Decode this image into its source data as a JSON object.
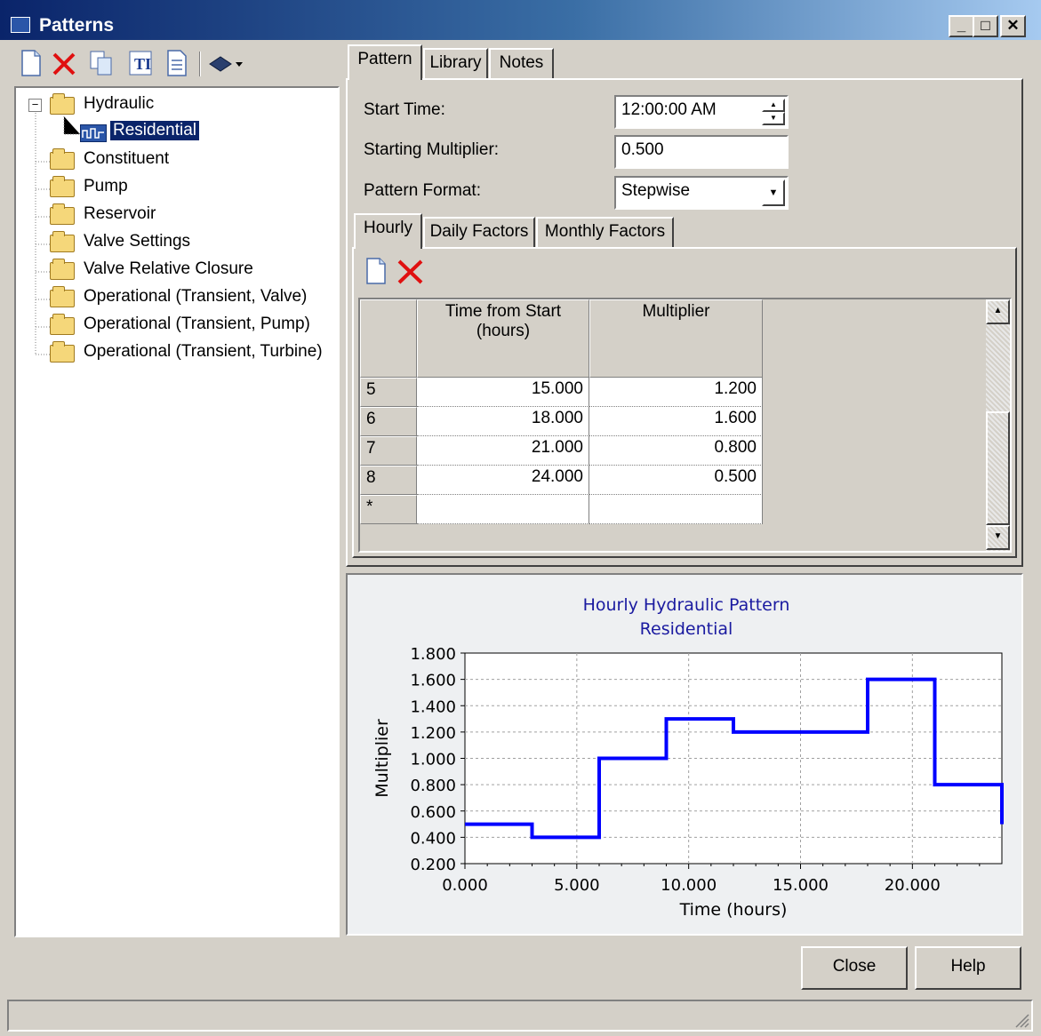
{
  "window": {
    "title": "Patterns"
  },
  "toolbar": {
    "icons": [
      "new-icon",
      "delete-icon",
      "copy-icon",
      "rename-icon",
      "report-icon",
      "library-dropdown-icon"
    ]
  },
  "tree": {
    "root": "Hydraulic",
    "expander": "⊟",
    "selected_child": "Residential",
    "folders": [
      "Constituent",
      "Pump",
      "Reservoir",
      "Valve Settings",
      "Valve Relative Closure",
      "Operational (Transient, Valve)",
      "Operational (Transient, Pump)",
      "Operational (Transient, Turbine)"
    ]
  },
  "tabs": {
    "pattern": "Pattern",
    "library": "Library",
    "notes": "Notes"
  },
  "form": {
    "start_time_label": "Start Time:",
    "start_time_value": "12:00:00 AM",
    "starting_multiplier_label": "Starting Multiplier:",
    "starting_multiplier_value": "0.500",
    "pattern_format_label": "Pattern Format:",
    "pattern_format_value": "Stepwise"
  },
  "subtabs": {
    "hourly": "Hourly",
    "daily": "Daily Factors",
    "monthly": "Monthly Factors"
  },
  "grid": {
    "col_time": "Time from Start (hours)",
    "col_multiplier": "Multiplier",
    "rows": [
      {
        "id": "5",
        "time": "15.000",
        "mult": "1.200"
      },
      {
        "id": "6",
        "time": "18.000",
        "mult": "1.600"
      },
      {
        "id": "7",
        "time": "21.000",
        "mult": "0.800"
      },
      {
        "id": "8",
        "time": "24.000",
        "mult": "0.500"
      }
    ],
    "new_row_marker": "*"
  },
  "chart_data": {
    "type": "line",
    "title": "Hourly Hydraulic Pattern",
    "subtitle": "Residential",
    "xlabel": "Time (hours)",
    "ylabel": "Multiplier",
    "xlim": [
      0,
      24
    ],
    "ylim": [
      0.2,
      1.8
    ],
    "xticks": [
      "0.000",
      "5.000",
      "10.000",
      "15.000",
      "20.000"
    ],
    "yticks": [
      "1.800",
      "1.600",
      "1.400",
      "1.200",
      "1.000",
      "0.800",
      "0.600",
      "0.400",
      "0.200"
    ],
    "step": true,
    "color": "#0000ff",
    "x": [
      0,
      3,
      6,
      9,
      12,
      15,
      18,
      21,
      24
    ],
    "y": [
      0.5,
      0.4,
      1.0,
      1.3,
      1.2,
      1.2,
      1.6,
      0.8,
      0.5
    ]
  },
  "buttons": {
    "close": "Close",
    "help": "Help"
  }
}
